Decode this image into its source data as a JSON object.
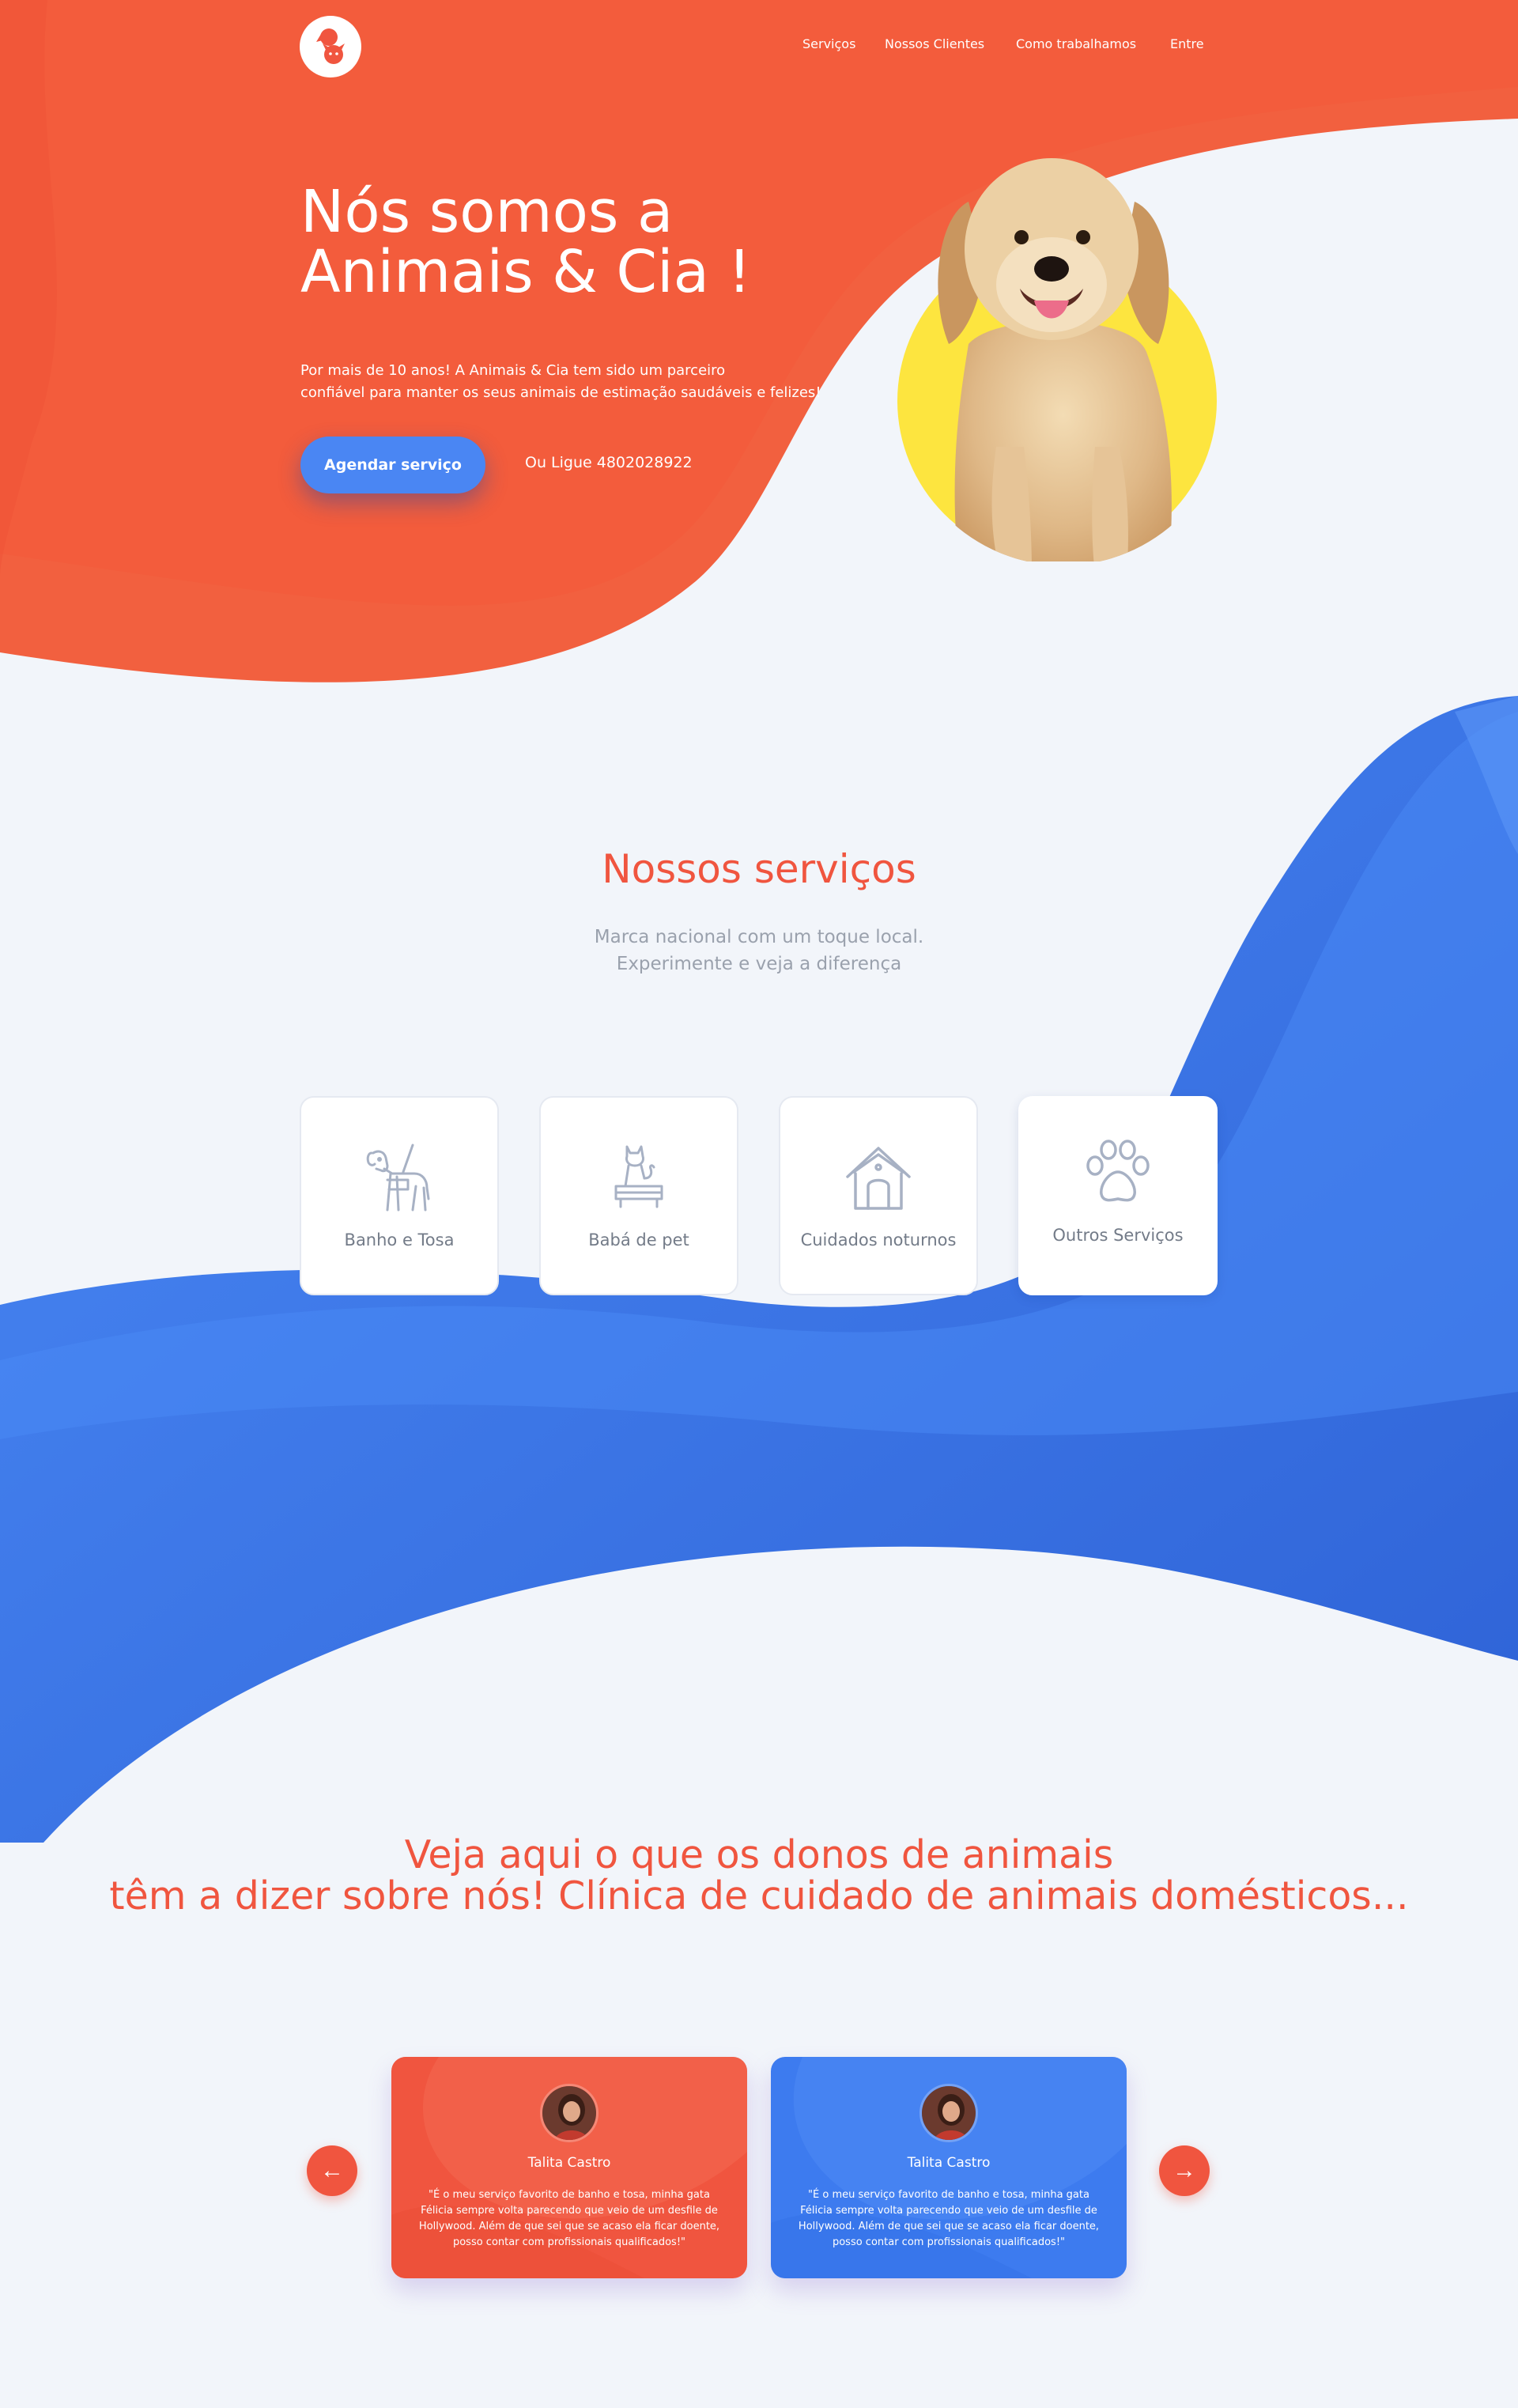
{
  "colors": {
    "primary_orange": "#f0553f",
    "primary_blue": "#3d7bef",
    "accent_yellow": "#fde53f",
    "page_bg": "#f2f5fa"
  },
  "nav": {
    "logo_icon": "dog-cat-logo-icon",
    "items": [
      "Serviços",
      "Nossos Clientes",
      "Como trabalhamos",
      "Entre"
    ]
  },
  "hero": {
    "title_lines": [
      "Nós somos a",
      "Animais & Cia !"
    ],
    "description_lines": [
      "Por mais de 10 anos! A Animais & Cia tem sido um parceiro",
      "confiável para manter os seus animais de estimação saudáveis e felizes!"
    ],
    "cta_label": "Agendar serviço",
    "call_text": "Ou Ligue 4802028922"
  },
  "services": {
    "title": "Nossos serviços",
    "subtitle_lines": [
      "Marca nacional com um toque local.",
      "Experimente e veja a diferença"
    ],
    "items": [
      {
        "label": "Banho e Tosa",
        "icon": "dog-leash-icon"
      },
      {
        "label": "Babá de pet",
        "icon": "cat-bed-icon"
      },
      {
        "label": "Cuidados noturnos",
        "icon": "dog-house-icon"
      },
      {
        "label": "Outros Serviços",
        "icon": "paw-icon"
      }
    ]
  },
  "testimonials": {
    "title_lines": [
      "Veja aqui o que os donos de animais",
      "têm a dizer sobre nós! Clínica de cuidado de animais domésticos..."
    ],
    "prev_icon": "arrow-left-icon",
    "next_icon": "arrow-right-icon",
    "prev_glyph": "←",
    "next_glyph": "→",
    "items": [
      {
        "name": "Talita Castro",
        "quote_lines": [
          "\"É o meu serviço favorito de banho e tosa, minha gata",
          "Félicia sempre volta parecendo que veio de um desfile de",
          "Hollywood. Além de que sei que se acaso ela ficar doente,",
          "posso contar com profissionais qualificados!\""
        ]
      },
      {
        "name": "Talita Castro",
        "quote_lines": [
          "\"É o meu serviço favorito de banho e tosa, minha gata",
          "Félicia sempre volta parecendo que veio de um desfile de",
          "Hollywood. Além de que sei que se acaso ela ficar doente,",
          "posso contar com profissionais qualificados!\""
        ]
      }
    ]
  }
}
